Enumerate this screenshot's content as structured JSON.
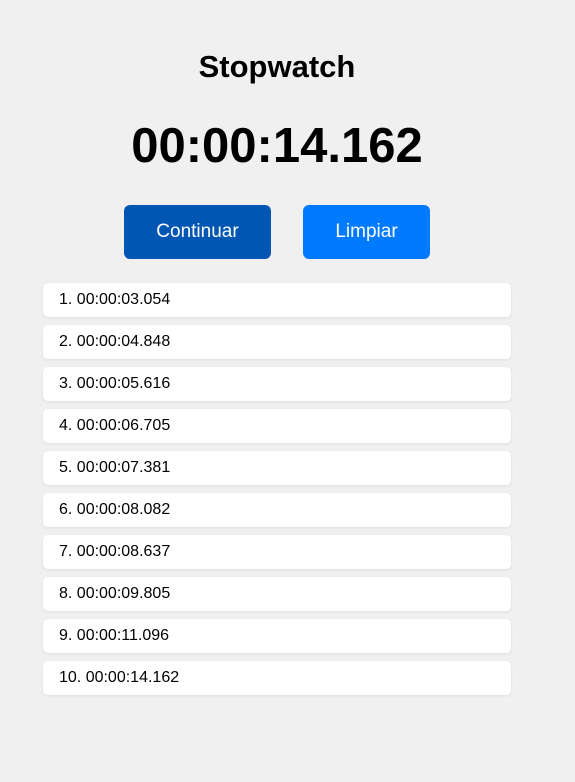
{
  "app": {
    "title": "Stopwatch",
    "time": "00:00:14.162"
  },
  "buttons": {
    "continue_label": "Continuar",
    "clear_label": "Limpiar"
  },
  "laps": [
    "1. 00:00:03.054",
    "2. 00:00:04.848",
    "3. 00:00:05.616",
    "4. 00:00:06.705",
    "5. 00:00:07.381",
    "6. 00:00:08.082",
    "7. 00:00:08.637",
    "8. 00:00:09.805",
    "9. 00:00:11.096",
    "10. 00:00:14.162"
  ],
  "colors": {
    "background": "#f0f0f0",
    "continue_button": "#0056b3",
    "clear_button": "#007bff",
    "lap_card": "#ffffff"
  }
}
